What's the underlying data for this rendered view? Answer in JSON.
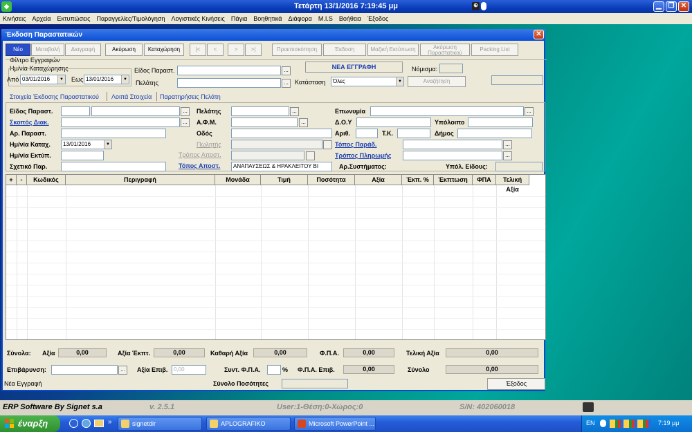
{
  "titlebar": {
    "title": "Τετάρτη  13/1/2016 7:19:45 μμ"
  },
  "menu": [
    "Κινήσεις",
    "Αρχεία",
    "Εκτυπώσεις",
    "Παραγγελίες/Τιμολόγηση",
    "Λογιστικές Κινήσεις",
    "Πάγια",
    "Βοηθητικά",
    "Διάφορα",
    "M.I.S",
    "Βοήθεια",
    "Έξοδος"
  ],
  "window": {
    "title": "Έκδοση Παραστατικών"
  },
  "toolbar": {
    "new": "Νέο",
    "edit": "Μεταβολή",
    "delete": "Διαγραφή",
    "cancel": "Ακύρωση",
    "save": "Καταχώρηση",
    "first": "|<",
    "prev": "<",
    "next": ">",
    "last": ">|",
    "preview": "Προεπισκόπηση",
    "print": "Έκδοση",
    "bulk_print": "Μαζική Εκτύπωση",
    "cancel_doc": "Ακύρωση Παραστατικού",
    "packing": "Packing List"
  },
  "filter": {
    "group_label": "Φίλτρο Εγγραφών",
    "date_label": "Ημ/νία Καταχώρησης",
    "from_label": "Από",
    "from_value": "03/01/2016",
    "to_label": "Εως",
    "to_value": "13/01/2016",
    "doctype_label": "Είδος Παραστ.",
    "customer_label": "Πελάτης",
    "new_record": "ΝΕΑ ΕΓΓΡΑΦΗ",
    "status_label": "Κατάσταση",
    "status_value": "Όλες",
    "currency_label": "Νόμισμα:",
    "search_button": "Αναζήτηση"
  },
  "tabs": [
    "Στοιχεία Έκδοσης Παραστατικού",
    "Λοιπά Στοιχεία",
    "Παρατηρήσεις Πελάτη"
  ],
  "form": {
    "doctype": "Είδος Παραστ.",
    "purpose": "Σκοπός Διακ.",
    "docno": "Αρ. Παραστ.",
    "regdate": "Ημ/νία Καταχ.",
    "regdate_value": "13/01/2016",
    "printdate": "Ημ/νία Εκτύπ.",
    "related": "Σχετικό Παρ.",
    "customer": "Πελάτης",
    "afm": "Α.Φ.Μ.",
    "street": "Οδός",
    "seller": "Πωλητής",
    "ship_method": "Τρόπος Αποστ.",
    "ship_place": "Τόπος Αποστ.",
    "ship_place_value": "ΑΝΑΠΑΥΣΕΩΣ & ΗΡΑΚΛΕΙΤΟΥ ΒΙ",
    "name": "Επωνυμία",
    "doy": "Δ.Ο.Υ",
    "balance": "Υπόλοιπο",
    "num": "Αριθ.",
    "tk": "Τ.Κ.",
    "municipality": "Δήμος",
    "delivery_place": "Τόπος Παράδ.",
    "payment": "Τρόπος Πληρωμής",
    "system_no": "Αρ.Συστήματος:",
    "item_balance": "Υπόλ. Είδους:"
  },
  "grid": {
    "columns": [
      "+",
      "-",
      "Κωδικός",
      "Περιγραφή",
      "Μονάδα",
      "Τιμή",
      "Ποσότητα",
      "Αξία",
      "Έκπ. %",
      "Έκπτωση",
      "ΦΠΑ",
      "Τελική Αξία"
    ]
  },
  "totals": {
    "totals_label": "Σύνολα:",
    "value_label": "Αξία",
    "value": "0,00",
    "disc_label": "Αξία Έκπτ.",
    "disc": "0,00",
    "net_label": "Καθαρή Αξία",
    "net": "0,00",
    "vat_label": "Φ.Π.Α.",
    "vat": "0,00",
    "final_label": "Τελική Αξία",
    "final": "0,00",
    "charge_label": "Επιβάρυνση:",
    "charge_val_label": "Αξία Επιβ.",
    "charge_val": "0,00",
    "vat_rate_label": "Συντ. Φ.Π.Α.",
    "pct": "%",
    "vat_charge_label": "Φ.Π.Α. Επιβ.",
    "vat_charge": "0,00",
    "sum_label": "Σύνολο",
    "sum": "0,00",
    "qty_label": "Σύνολο Ποσότητες",
    "status_msg": "Νέα Εγγραφή",
    "exit": "Έξοδος"
  },
  "statusbar": {
    "brand": "ERP Software By Signet s.a",
    "version": "v. 2.5.1",
    "user": "User:1-Θέση:0-Χώρος:0",
    "sn": "S/N: 402060018"
  },
  "taskbar": {
    "start": "έναρξη",
    "tasks": [
      "signetdir",
      "APLOGRAFIKO",
      "Microsoft PowerPoint ..."
    ],
    "lang": "EN",
    "time": "7:19 μμ"
  }
}
